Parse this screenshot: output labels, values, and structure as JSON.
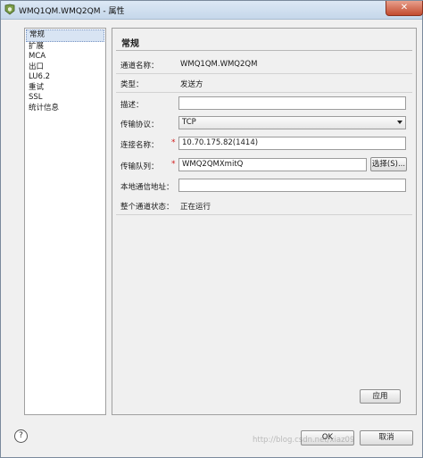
{
  "window": {
    "title": "WMQ1QM.WMQ2QM - 属性",
    "close_icon": "close-icon",
    "title_icon": "properties-icon"
  },
  "nav": {
    "items": [
      {
        "label": "常规",
        "selected": true
      },
      {
        "label": "扩展"
      },
      {
        "label": "MCA"
      },
      {
        "label": "出口"
      },
      {
        "label": "LU6.2"
      },
      {
        "label": "重试"
      },
      {
        "label": "SSL"
      },
      {
        "label": "统计信息"
      }
    ]
  },
  "panel": {
    "title": "常规",
    "channel_name_label": "通道名称：",
    "channel_name_value": "WMQ1QM.WMQ2QM",
    "type_label": "类型：",
    "type_value": "发送方",
    "description_label": "描述：",
    "description_value": "",
    "protocol_label": "传输协议：",
    "protocol_value": "TCP",
    "conn_name_label": "连接名称：",
    "conn_name_value": "10.70.175.82(1414)",
    "xmitq_label": "传输队列：",
    "xmitq_value": "WMQ2QMXmitQ",
    "select_button": "选择(S)...",
    "local_addr_label": "本地通信地址：",
    "local_addr_value": "",
    "status_label": "整个通道状态：",
    "status_value": "正在运行",
    "required_mark": "*",
    "apply_button": "应用"
  },
  "footer": {
    "help_symbol": "?",
    "ok_button": "OK",
    "cancel_button": "取消",
    "watermark": "http://blog.csdn.net/xiaz09"
  },
  "colors": {
    "title_bar": "#c5d7ea",
    "selected_item": "#d8e4f3",
    "required": "#d21d1d",
    "close_button": "#c24b2f"
  }
}
